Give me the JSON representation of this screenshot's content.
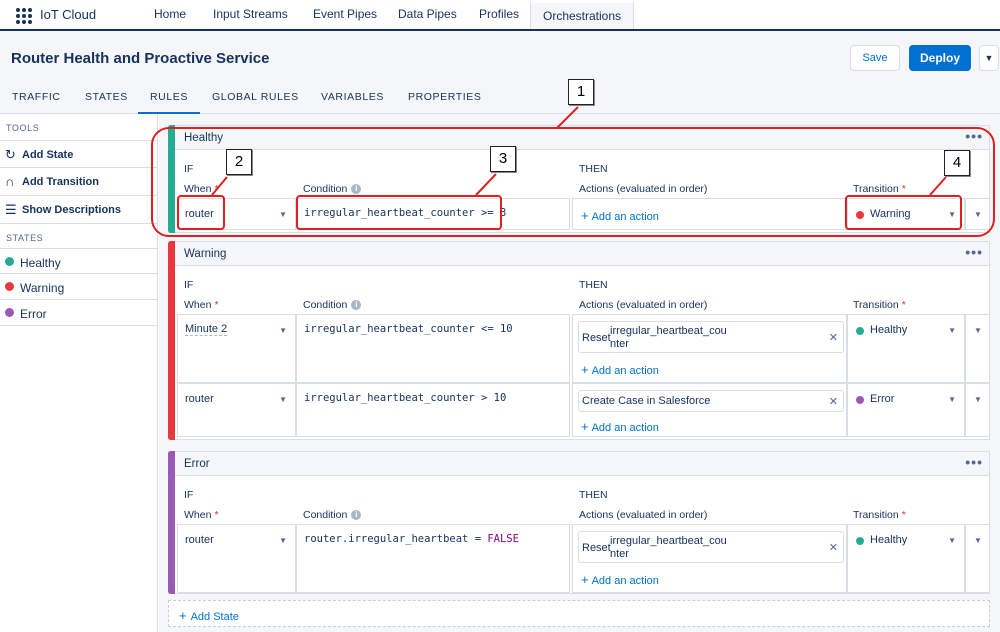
{
  "app": {
    "name": "IoT Cloud"
  },
  "nav": {
    "tabs": [
      "Home",
      "Input Streams",
      "Event Pipes",
      "Data Pipes",
      "Profiles",
      "Orchestrations"
    ],
    "active": "Orchestrations"
  },
  "header": {
    "title": "Router Health and Proactive Service",
    "save_label": "Save",
    "deploy_label": "Deploy"
  },
  "subtabs": [
    "TRAFFIC",
    "STATES",
    "RULES",
    "GLOBAL RULES",
    "VARIABLES",
    "PROPERTIES"
  ],
  "sidebar": {
    "tools_heading": "TOOLS",
    "tools": [
      {
        "label": "Add State",
        "icon": "refresh-add-icon"
      },
      {
        "label": "Add Transition",
        "icon": "transition-icon"
      },
      {
        "label": "Show Descriptions",
        "icon": "list-icon"
      }
    ],
    "states_heading": "STATES",
    "states": [
      {
        "label": "Healthy",
        "color": "#26ab95"
      },
      {
        "label": "Warning",
        "color": "#e8383d"
      },
      {
        "label": "Error",
        "color": "#9b59b6"
      }
    ]
  },
  "labels": {
    "if": "IF",
    "then": "THEN",
    "when": "When",
    "condition": "Condition",
    "actions": "Actions (evaluated in order)",
    "transition": "Transition",
    "add_action": "Add an action",
    "add_state": "Add State",
    "more": "•••",
    "required": "*"
  },
  "states": [
    {
      "name": "Healthy",
      "rules": [
        {
          "when": "router",
          "condition": "irregular_heartbeat_counter >= 3",
          "actions": [],
          "transition": "Warning"
        }
      ]
    },
    {
      "name": "Warning",
      "rules": [
        {
          "when": "Minute 2",
          "condition": "irregular_heartbeat_counter <= 10",
          "actions": [
            {
              "prefix": "Reset",
              "line1": "irregular_heartbeat_cou",
              "line2": "nter"
            }
          ],
          "transition": "Healthy"
        },
        {
          "when": "router",
          "condition": "irregular_heartbeat_counter > 10",
          "actions": [
            {
              "label": "Create Case in Salesforce"
            }
          ],
          "transition": "Error"
        }
      ]
    },
    {
      "name": "Error",
      "rules": [
        {
          "when": "router",
          "condition_obj": "router.irregular_heartbeat",
          "condition_op": " = ",
          "condition_val": "FALSE",
          "actions": [
            {
              "prefix": "Reset",
              "line1": "irregular_heartbeat_cou",
              "line2": "nter"
            }
          ],
          "transition": "Healthy"
        }
      ]
    }
  ],
  "callouts": [
    "1",
    "2",
    "3",
    "4"
  ],
  "colors": {
    "healthy": "#26ab95",
    "warning": "#e8383d",
    "error": "#9b59b6",
    "brand": "#0070d2",
    "callout": "#e02020"
  }
}
